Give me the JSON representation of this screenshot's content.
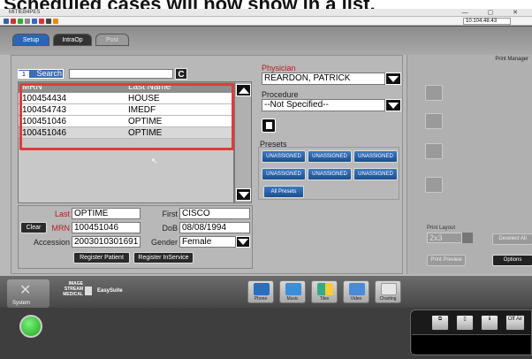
{
  "caption": "Scheduled cases will now show in a list.",
  "window": {
    "title": "MITIEB4PES"
  },
  "toolbar": {
    "address": "10.104.48.43"
  },
  "tabs": [
    {
      "label": "Setup"
    },
    {
      "label": "IntraOp"
    },
    {
      "label": "Post"
    }
  ],
  "search": {
    "label": "Search",
    "number": "1",
    "value": "",
    "clear_label": "C"
  },
  "grid": {
    "col_mrn": "MRN",
    "col_last": "Last Name",
    "rows": [
      {
        "mrn": "100454434",
        "last": "HOUSE"
      },
      {
        "mrn": "100454743",
        "last": "IMEDF"
      },
      {
        "mrn": "100451046",
        "last": "OPTIME"
      },
      {
        "mrn": "100451046",
        "last": "OPTIME"
      }
    ]
  },
  "patient": {
    "last_label": "Last",
    "last": "OPTIME",
    "first_label": "First",
    "first": "CISCO",
    "mrn_label": "MRN",
    "mrn": "100451046",
    "dob_label": "DoB",
    "dob": "08/08/1994",
    "accession_label": "Accession",
    "accession": "2003010301691",
    "gender_label": "Gender",
    "gender": "Female",
    "clear_label": "Clear",
    "register_patient": "Register Patient",
    "register_inservice": "Register InService"
  },
  "physician": {
    "label": "Physician",
    "value": "REARDON, PATRICK"
  },
  "procedure": {
    "label": "Procedure",
    "value": "--Not Specified--"
  },
  "presets": {
    "label": "Presets",
    "items": [
      "UNASSIGNED",
      "UNASSIGNED",
      "UNASSIGNED",
      "UNASSIGNED",
      "UNASSIGNED",
      "UNASSIGNED"
    ],
    "all_presets": "All Presets"
  },
  "print_manager": {
    "title": "Print Manager"
  },
  "print_layout": {
    "label": "Print Layout",
    "value": "2x3",
    "print_preview": "Print Preview",
    "deselect_all": "Deselect All",
    "options": "Options"
  },
  "brand": {
    "image_stream": "IMAGE STREAM",
    "medical": "MEDICAL",
    "easysuite": "EasySuite"
  },
  "bottom": {
    "system_label": "System",
    "icons": [
      {
        "name": "Phone",
        "icon": "phone-icon"
      },
      {
        "name": "Music",
        "icon": "music-icon"
      },
      {
        "name": "Tiles",
        "icon": "tiles-icon"
      },
      {
        "name": "Video",
        "icon": "video-icon"
      },
      {
        "name": "Charting",
        "icon": "charting-icon"
      }
    ]
  },
  "controls": {
    "off_air": "Off Air"
  },
  "colors": {
    "accent_blue": "#2b66b5",
    "highlight_red": "#e03b3b",
    "status_green": "#2fd02f"
  }
}
